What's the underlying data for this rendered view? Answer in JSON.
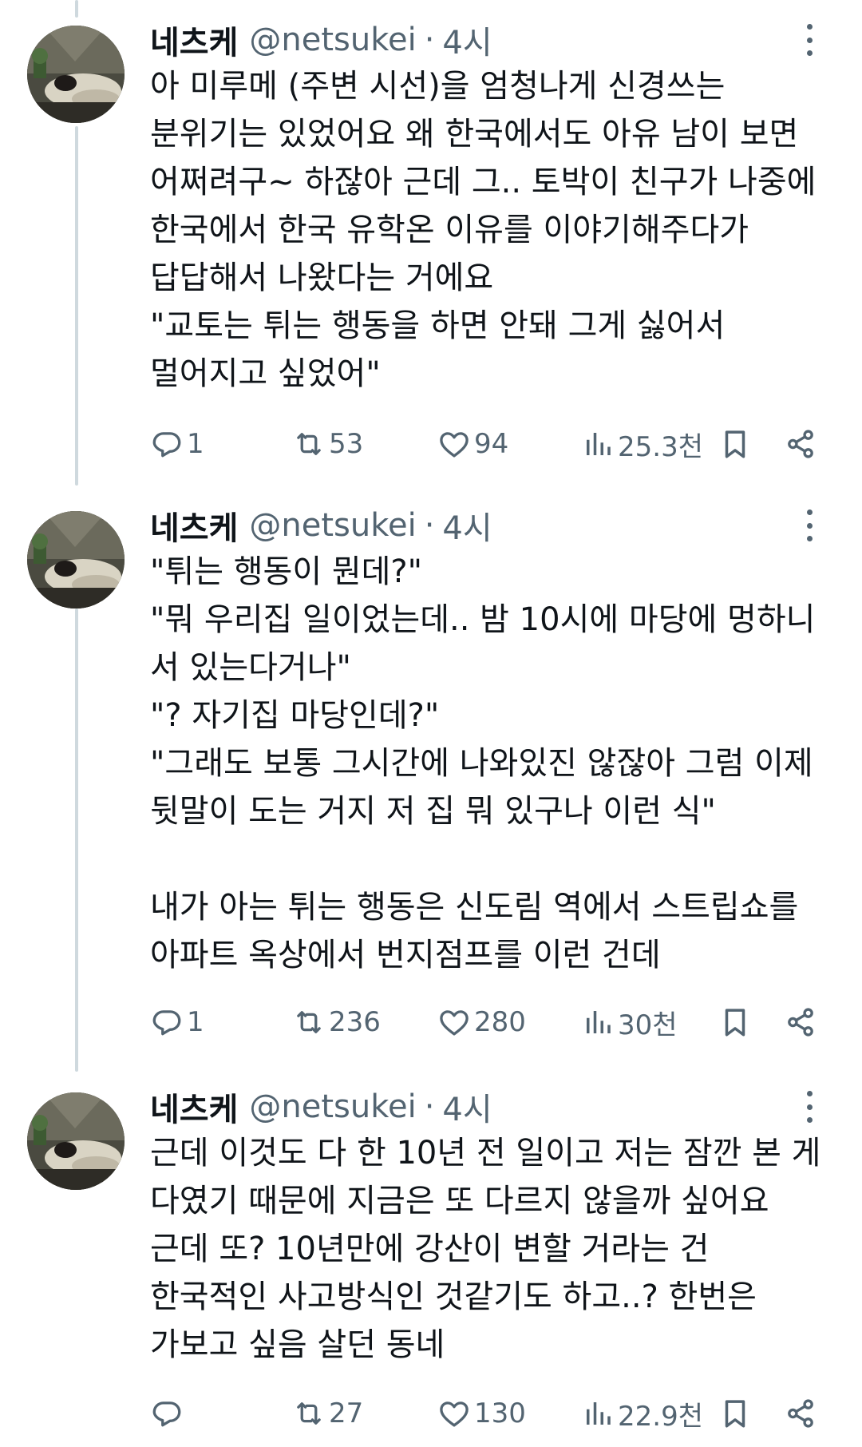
{
  "tweets": [
    {
      "name": "네츠케",
      "handle": "@netsukei",
      "separator": "·",
      "time": "4시",
      "lines": [
        "아 미루메 (주변 시선)을 엄청나게 신경쓰는",
        "분위기는 있었어요 왜 한국에서도 아유 남이 보면",
        "어쩌려구~ 하잖아 근데 그.. 토박이 친구가 나중에",
        "한국에서 한국 유학온 이유를 이야기해주다가",
        "답답해서 나왔다는 거에요",
        "\"교토는 튀는 행동을 하면 안돼 그게 싫어서",
        "멀어지고 싶었어\""
      ],
      "replies": "1",
      "retweets": "53",
      "likes": "94",
      "views": "25.3천"
    },
    {
      "name": "네츠케",
      "handle": "@netsukei",
      "separator": "·",
      "time": "4시",
      "lines": [
        "\"튀는 행동이 뭔데?\"",
        "\"뭐 우리집 일이었는데.. 밤 10시에 마당에 멍하니",
        "서 있는다거나\"",
        "\"? 자기집 마당인데?\"",
        "\"그래도 보통 그시간에 나와있진 않잖아 그럼 이제",
        "뒷말이 도는 거지 저 집 뭐 있구나 이런 식\"",
        "",
        "내가 아는 튀는 행동은 신도림 역에서 스트립쇼를",
        "아파트 옥상에서 번지점프를 이런 건데"
      ],
      "replies": "1",
      "retweets": "236",
      "likes": "280",
      "views": "30천"
    },
    {
      "name": "네츠케",
      "handle": "@netsukei",
      "separator": "·",
      "time": "4시",
      "lines": [
        "근데 이것도 다 한 10년 전 일이고 저는 잠깐 본 게",
        "다였기 때문에 지금은 또 다르지 않을까 싶어요",
        "근데 또? 10년만에 강산이 변할 거라는 건",
        "한국적인 사고방식인 것같기도 하고..? 한번은",
        "가보고 싶음 살던 동네"
      ],
      "replies": "",
      "retweets": "27",
      "likes": "130",
      "views": "22.9천"
    }
  ],
  "icons": {
    "reply": "reply-icon",
    "retweet": "retweet-icon",
    "like": "heart-icon",
    "views": "views-icon",
    "bookmark": "bookmark-icon",
    "share": "share-icon",
    "more": "more-options-icon"
  },
  "colors": {
    "text": "#0f1419",
    "secondary": "#536471",
    "thread_line": "#cfd9de",
    "background": "#ffffff"
  }
}
